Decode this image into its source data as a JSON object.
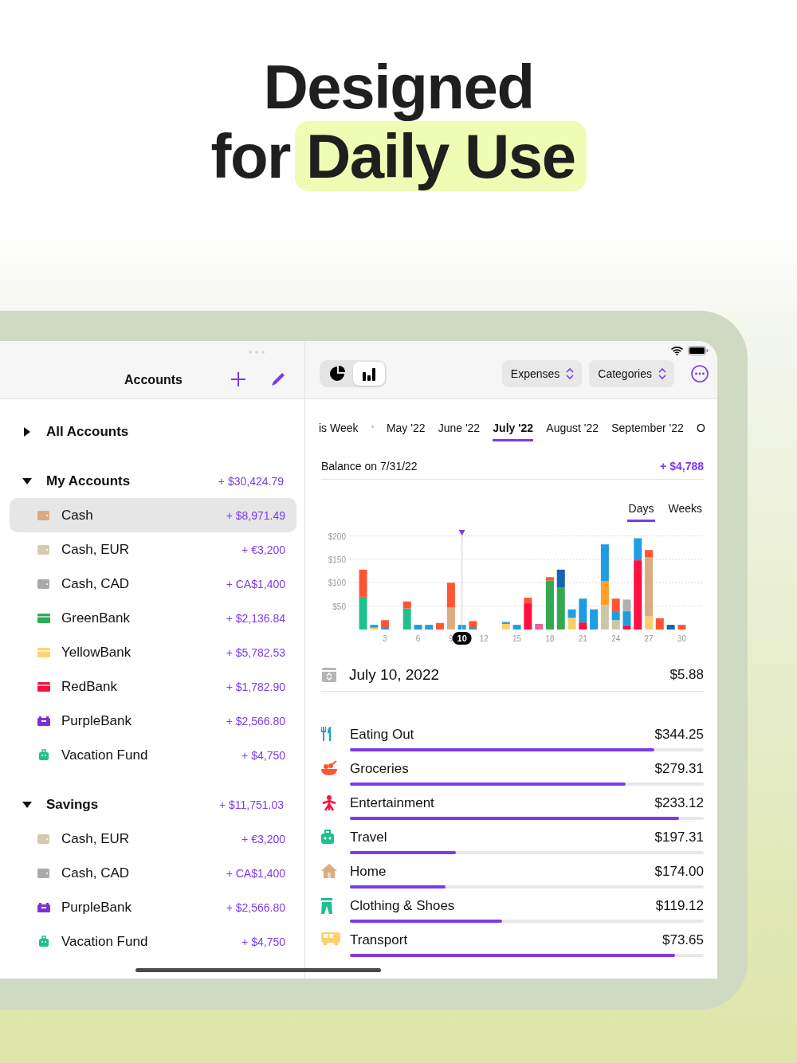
{
  "headline": {
    "line1": "Designed",
    "line2": "for",
    "highlight": "Daily Use"
  },
  "sidebar": {
    "title": "Accounts",
    "groups": [
      {
        "name": "All Accounts",
        "expanded": false
      },
      {
        "name": "My Accounts",
        "expanded": true,
        "total": "+ $30,424.79",
        "children": [
          {
            "name": "Cash",
            "amount": "+ $8,971.49",
            "kind": "wallet",
            "color": "#dcaa80",
            "selected": true
          },
          {
            "name": "Cash, EUR",
            "amount": "+ €3,200",
            "kind": "wallet",
            "color": "#d4cbac",
            "selected": false
          },
          {
            "name": "Cash, CAD",
            "amount": "+ CA$1,400",
            "kind": "wallet",
            "color": "#a9a9a9",
            "selected": false
          },
          {
            "name": "GreenBank",
            "amount": "+ $2,136.84",
            "kind": "card",
            "color": "#2eaa55",
            "selected": false
          },
          {
            "name": "YellowBank",
            "amount": "+ $5,782.53",
            "kind": "card",
            "color": "#ffd27a",
            "selected": false
          },
          {
            "name": "RedBank",
            "amount": "+ $1,782.90",
            "kind": "card",
            "color": "#f0143c",
            "selected": false
          },
          {
            "name": "PurpleBank",
            "amount": "+ $2,566.80",
            "kind": "safe",
            "color": "#8030d0",
            "selected": false
          },
          {
            "name": "Vacation Fund",
            "amount": "+ $4,750",
            "kind": "suitcase",
            "color": "#20c08e",
            "selected": false
          }
        ]
      },
      {
        "name": "Savings",
        "expanded": true,
        "total": "+ $11,751.03",
        "children": [
          {
            "name": "Cash, EUR",
            "amount": "+ €3,200",
            "kind": "wallet",
            "color": "#d4cbac",
            "selected": false
          },
          {
            "name": "Cash, CAD",
            "amount": "+ CA$1,400",
            "kind": "wallet",
            "color": "#a9a9a9",
            "selected": false
          },
          {
            "name": "PurpleBank",
            "amount": "+ $2,566.80",
            "kind": "safe",
            "color": "#8030d0",
            "selected": false
          },
          {
            "name": "Vacation Fund",
            "amount": "+ $4,750",
            "kind": "suitcase",
            "color": "#20c08e",
            "selected": false
          }
        ]
      }
    ]
  },
  "main": {
    "view_toggle": [
      {
        "kind": "pie",
        "selected": false
      },
      {
        "kind": "bars",
        "selected": true
      }
    ],
    "pickers": [
      "Expenses",
      "Categories"
    ],
    "periods": [
      {
        "label": "is Week",
        "selected": false
      },
      {
        "label": "May '22",
        "selected": false
      },
      {
        "label": "June '22",
        "selected": false
      },
      {
        "label": "July '22",
        "selected": true
      },
      {
        "label": "August '22",
        "selected": false
      },
      {
        "label": "September '22",
        "selected": false
      },
      {
        "label": "O",
        "selected": false
      }
    ],
    "balance": {
      "label": "Balance on 7/31/22",
      "value": "+ $4,788"
    },
    "granularity": [
      {
        "label": "Days",
        "selected": true
      },
      {
        "label": "Weeks",
        "selected": false
      }
    ],
    "chart_data": {
      "type": "bar",
      "stacked": true,
      "grid": true,
      "x": [
        1,
        2,
        3,
        5,
        6,
        7,
        8,
        9,
        10,
        11,
        14,
        15,
        16,
        17,
        18,
        19,
        20,
        21,
        22,
        23,
        24,
        25,
        26,
        27,
        28,
        29,
        30
      ],
      "xlim": [
        -0.2,
        32
      ],
      "xticks": [
        3,
        6,
        9,
        12,
        15,
        18,
        21,
        24,
        27,
        30
      ],
      "ylim": [
        0,
        200
      ],
      "yticks": [
        {
          "value": 50,
          "label": "$50"
        },
        {
          "value": 100,
          "label": "$100"
        },
        {
          "value": 150,
          "label": "$150"
        },
        {
          "value": 200,
          "label": "$200"
        }
      ],
      "annotations": [
        {
          "x": 10,
          "text": "10"
        }
      ],
      "series": [
        {
          "color": "#20c08e",
          "values": [
            70,
            null,
            null,
            45,
            null,
            null,
            null,
            null,
            null,
            null,
            null,
            null,
            null,
            null,
            null,
            null,
            null,
            null,
            null,
            null,
            null,
            null,
            null,
            null,
            null,
            null,
            null
          ]
        },
        {
          "color": "#34a853",
          "values": [
            null,
            null,
            null,
            null,
            null,
            null,
            null,
            null,
            null,
            null,
            null,
            null,
            null,
            null,
            105,
            90,
            null,
            null,
            null,
            null,
            null,
            null,
            null,
            null,
            null,
            null,
            null
          ]
        },
        {
          "color": "#ff1040",
          "values": [
            null,
            null,
            null,
            null,
            null,
            null,
            null,
            null,
            null,
            null,
            null,
            null,
            56,
            null,
            null,
            null,
            null,
            15,
            null,
            null,
            null,
            9,
            148,
            null,
            null,
            null,
            null
          ]
        },
        {
          "color": "#ffcf6b",
          "values": [
            null,
            4,
            null,
            null,
            null,
            null,
            null,
            null,
            null,
            null,
            12,
            null,
            null,
            null,
            null,
            null,
            25,
            null,
            null,
            null,
            null,
            null,
            null,
            28,
            null,
            null,
            null
          ]
        },
        {
          "color": "#d9ac82",
          "values": [
            null,
            null,
            null,
            null,
            null,
            null,
            null,
            47,
            null,
            null,
            null,
            null,
            null,
            null,
            null,
            null,
            null,
            null,
            null,
            null,
            null,
            null,
            null,
            127,
            null,
            null,
            null
          ]
        },
        {
          "color": "#cdc7a8",
          "values": [
            null,
            null,
            null,
            null,
            null,
            null,
            null,
            null,
            null,
            null,
            null,
            null,
            null,
            null,
            null,
            null,
            null,
            null,
            null,
            52,
            20,
            null,
            null,
            null,
            null,
            null,
            null
          ]
        },
        {
          "color": "#1565b0",
          "values": [
            null,
            null,
            null,
            null,
            null,
            null,
            null,
            null,
            null,
            null,
            null,
            null,
            null,
            null,
            null,
            38,
            null,
            null,
            null,
            null,
            null,
            null,
            null,
            null,
            null,
            10,
            null
          ]
        },
        {
          "color": "#ffa126",
          "values": [
            null,
            null,
            null,
            null,
            null,
            null,
            null,
            null,
            null,
            null,
            null,
            null,
            null,
            null,
            null,
            null,
            null,
            null,
            null,
            52,
            null,
            null,
            null,
            null,
            null,
            null,
            null
          ]
        },
        {
          "color": "#1e9de0",
          "values": [
            null,
            6,
            5,
            null,
            10,
            10,
            null,
            null,
            10,
            5,
            4,
            10,
            null,
            null,
            null,
            null,
            18,
            51,
            43,
            78,
            19,
            30,
            47,
            null,
            null,
            null,
            null
          ]
        },
        {
          "color": "#b0b0b0",
          "values": [
            null,
            null,
            null,
            null,
            null,
            null,
            null,
            null,
            null,
            null,
            null,
            null,
            null,
            null,
            null,
            null,
            null,
            null,
            null,
            null,
            null,
            25,
            null,
            null,
            null,
            null,
            null
          ]
        },
        {
          "color": "#f06292",
          "values": [
            null,
            null,
            null,
            null,
            null,
            null,
            null,
            null,
            null,
            null,
            null,
            null,
            null,
            12,
            null,
            null,
            null,
            null,
            null,
            null,
            null,
            null,
            null,
            null,
            null,
            null,
            null
          ]
        },
        {
          "color": "#ff5533",
          "values": [
            58,
            null,
            15,
            15,
            null,
            null,
            14,
            53,
            null,
            13,
            null,
            null,
            12,
            null,
            7,
            null,
            null,
            null,
            null,
            null,
            27,
            null,
            null,
            15,
            24,
            null,
            10
          ]
        }
      ]
    },
    "selected_day": {
      "date": "July 10, 2022",
      "amount": "$5.88"
    },
    "categories": [
      {
        "name": "Eating Out",
        "amount": "$344.25",
        "level": 0.86,
        "kind": "cutlery",
        "color": "#1e9de0"
      },
      {
        "name": "Groceries",
        "amount": "$279.31",
        "level": 0.78,
        "kind": "bowl",
        "color": "#ff5533"
      },
      {
        "name": "Entertainment",
        "amount": "$233.12",
        "level": 0.93,
        "kind": "carousel",
        "color": "#ff1040"
      },
      {
        "name": "Travel",
        "amount": "$197.31",
        "level": 0.3,
        "kind": "suitcase",
        "color": "#20c08e"
      },
      {
        "name": "Home",
        "amount": "$174.00",
        "level": 0.27,
        "kind": "house",
        "color": "#dcaa80"
      },
      {
        "name": "Clothing & Shoes",
        "amount": "$119.12",
        "level": 0.43,
        "kind": "pants",
        "color": "#20c08e"
      },
      {
        "name": "Transport",
        "amount": "$73.65",
        "level": 0.92,
        "kind": "bus",
        "color": "#ffcf6b"
      }
    ]
  }
}
